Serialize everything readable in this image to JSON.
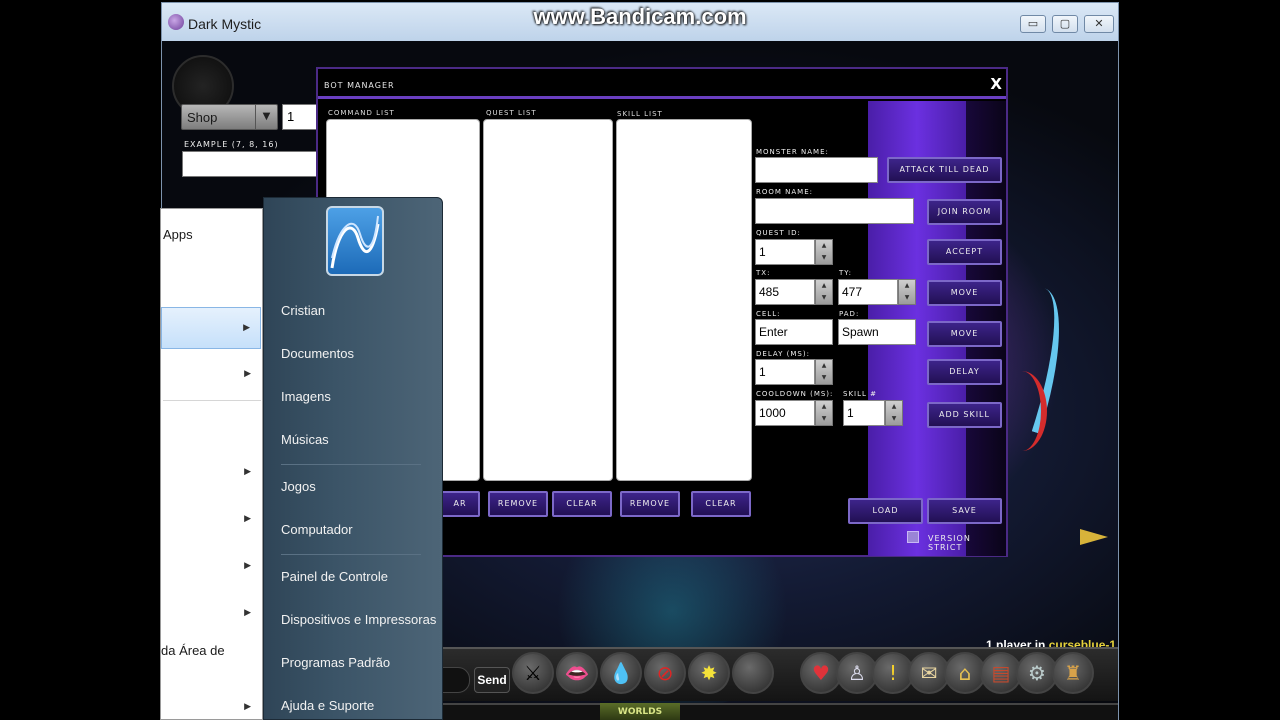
{
  "watermark": "www.Bandicam.com",
  "window": {
    "title": "Dark Mystic",
    "controls": {
      "minimize": "▭",
      "maximize": "▢",
      "close": "✕"
    }
  },
  "hud": {
    "shop_label": "Shop",
    "quantity_value": "1",
    "example_label": "EXAMPLE (7, 8, 16)"
  },
  "bot_manager": {
    "title": "BOT MANAGER",
    "close": "X",
    "lists": {
      "command": "COMMAND LIST",
      "quest": "QUEST LIST",
      "skill": "SKILL LIST"
    },
    "fields": {
      "monster_name_label": "MONSTER NAME:",
      "room_name_label": "ROOM NAME:",
      "quest_id_label": "QUEST ID:",
      "quest_id_value": "1",
      "tx_label": "TX:",
      "tx_value": "485",
      "ty_label": "TY:",
      "ty_value": "477",
      "cell_label": "CELL:",
      "cell_value": "Enter",
      "pad_label": "PAD:",
      "pad_value": "Spawn",
      "delay_label": "DELAY (MS):",
      "delay_value": "1",
      "cooldown_label": "COOLDOWN (MS):",
      "cooldown_value": "1000",
      "skill_label": "SKILL #",
      "skill_value": "1"
    },
    "buttons": {
      "attack_till_dead": "ATTACK TILL DEAD",
      "join_room": "JOIN ROOM",
      "accept": "ACCEPT",
      "move1": "MOVE",
      "move2": "MOVE",
      "delay": "DELAY",
      "add_skill": "ADD SKILL",
      "command_clear": "AR",
      "quest_remove": "REMOVE",
      "quest_clear": "CLEAR",
      "skill_remove": "REMOVE",
      "skill_clear": "CLEAR",
      "load": "LOAD",
      "save": "SAVE"
    },
    "version_strict": "VERSION STRICT"
  },
  "game": {
    "player_count": "1 player in ",
    "server": "curseblue-1",
    "player_caret": "▲",
    "send_label": "Send",
    "worlds_logo": "WORLDS"
  },
  "start_menu": {
    "left_items": [
      {
        "label": "Apps"
      },
      {
        "label": ""
      },
      {
        "label": ""
      },
      {
        "label": ""
      },
      {
        "label": ""
      },
      {
        "label": ""
      },
      {
        "label": ""
      },
      {
        "label": "da Área de"
      },
      {
        "label": ""
      }
    ],
    "right_items": [
      {
        "label": "Cristian"
      },
      {
        "label": "Documentos"
      },
      {
        "label": "Imagens"
      },
      {
        "label": "Músicas"
      },
      {
        "label": "Jogos"
      },
      {
        "label": "Computador"
      },
      {
        "label": "Painel de Controle"
      },
      {
        "label": "Dispositivos e Impressoras"
      },
      {
        "label": "Programas Padrão"
      },
      {
        "label": "Ajuda e Suporte"
      }
    ]
  },
  "icons": {
    "swords": "⚔",
    "lips": "👄",
    "potion": "💧",
    "no": "⊘",
    "burst": "✸",
    "heart": "♥",
    "person": "♙",
    "alert": "!",
    "scroll": "✉",
    "house": "⌂",
    "book": "▤",
    "gear": "⚙",
    "bag": "♜"
  }
}
